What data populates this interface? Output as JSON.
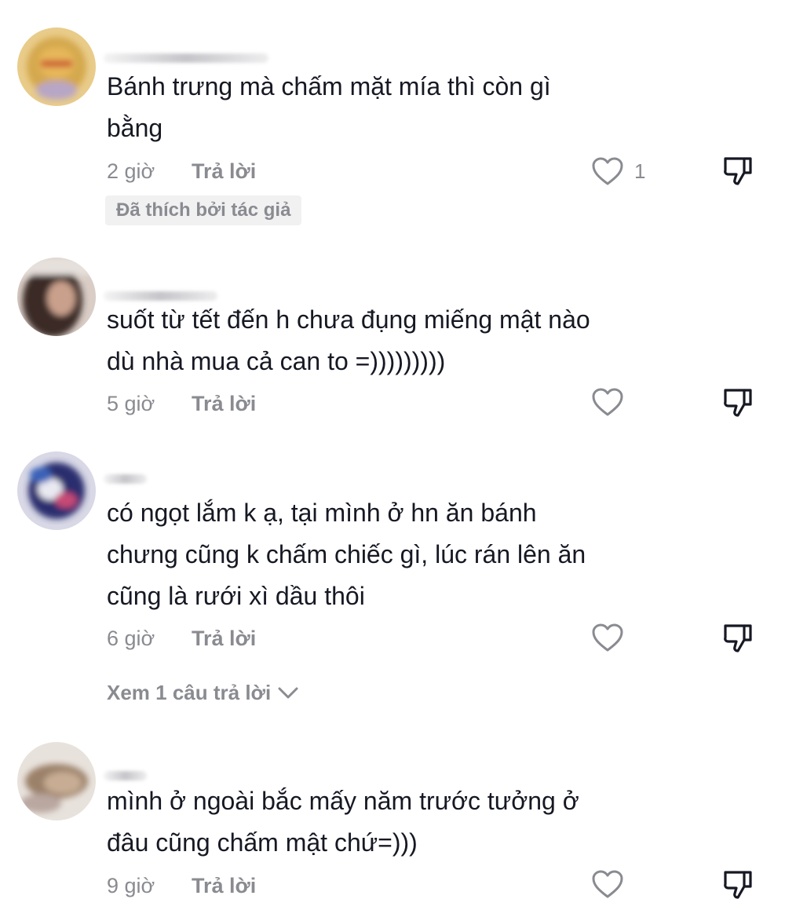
{
  "comments": [
    {
      "text": "Bánh trưng mà chấm mặt mía thì còn gì\nbằng",
      "time": "2 giờ",
      "reply_label": "Trả lời",
      "like_count": "1",
      "badge": "Đã thích bởi tác giả"
    },
    {
      "text": "suốt từ tết đến h chưa đụng miếng mật nào\ndù nhà mua cả can to =)))))))))",
      "time": "5 giờ",
      "reply_label": "Trả lời"
    },
    {
      "text": "có ngọt lắm k ạ, tại mình ở hn ăn bánh\nchưng cũng k chấm chiếc gì, lúc rán lên ăn\ncũng là rưới xì dầu thôi",
      "time": "6 giờ",
      "reply_label": "Trả lời",
      "view_replies": "Xem 1 câu trả lời"
    },
    {
      "text": "mình ở ngoài bắc mấy năm trước tưởng ở\nđâu cũng chấm mật chứ=)))",
      "time": "9 giờ",
      "reply_label": "Trả lời"
    }
  ],
  "icons": {
    "like": "heart-outline-icon",
    "dislike": "thumbs-down-icon",
    "expand": "chevron-down-icon"
  },
  "colors": {
    "text": "#161823",
    "meta": "#8a8b91",
    "badge_bg": "#f1f1f2"
  }
}
